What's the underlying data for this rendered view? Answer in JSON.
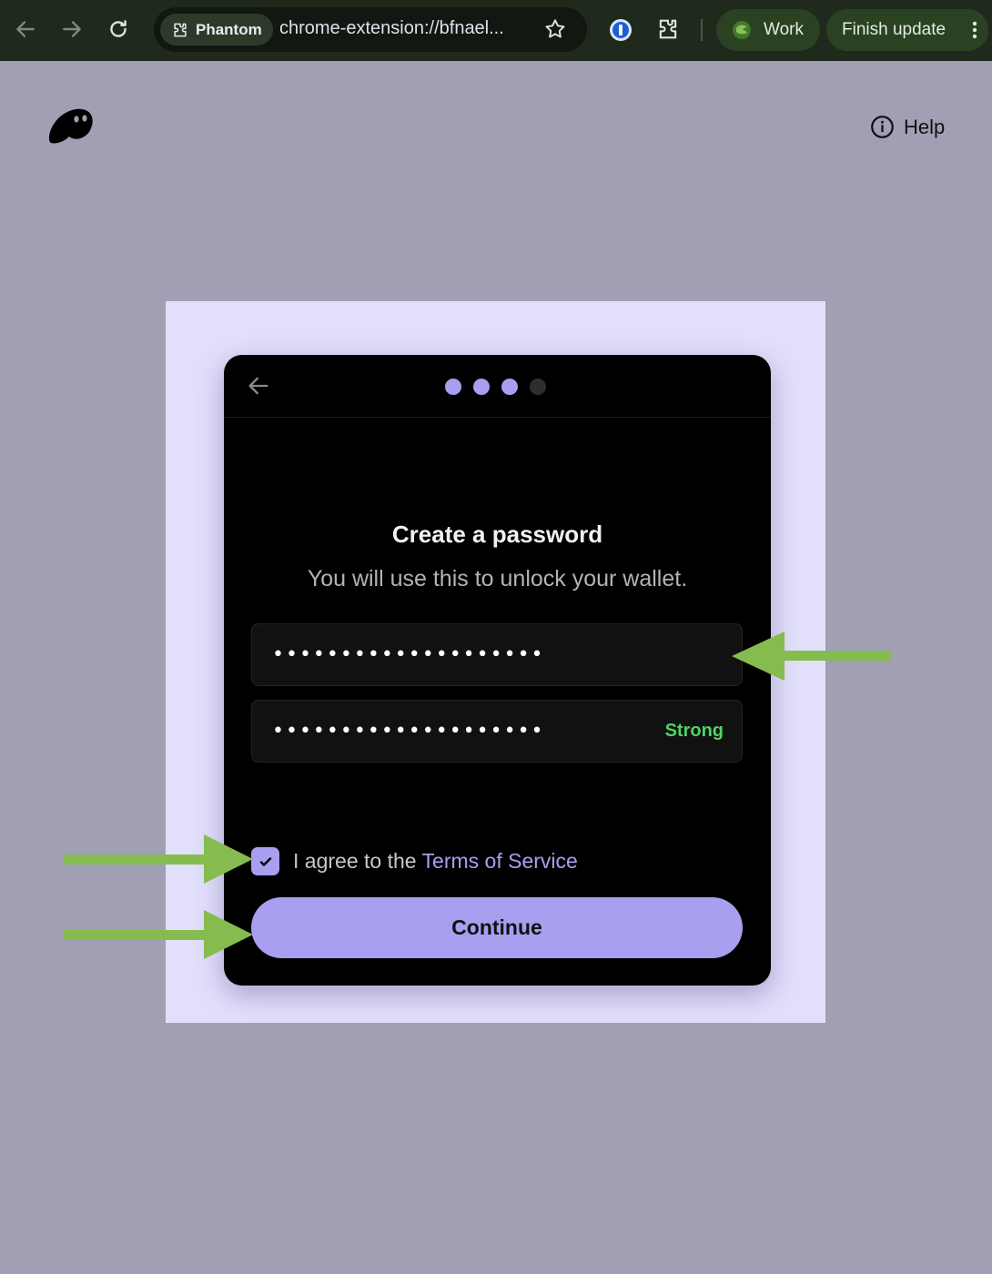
{
  "browser": {
    "site_chip_label": "Phantom",
    "url": "chrome-extension://bfnael...",
    "profile_label": "Work",
    "update_label": "Finish update"
  },
  "header": {
    "help_label": "Help"
  },
  "onboarding": {
    "steps_total": 4,
    "steps_completed": 3,
    "title": "Create a password",
    "subtitle": "You will use this to unlock your wallet.",
    "password_value": "••••••••••••••••••••",
    "confirm_password_value": "••••••••••••••••••••",
    "strength_label": "Strong",
    "agree_prefix": "I agree to the",
    "terms_link_label": "Terms of Service",
    "terms_checked": true,
    "continue_label": "Continue"
  },
  "colors": {
    "accent": "#a89ff0",
    "strength_ok": "#4ed464",
    "annotation_arrow": "#86bb4f",
    "page_background": "#a09fb4",
    "frame_background": "#e2dffb",
    "card_background": "#000000"
  },
  "icons": {
    "nav_back": "arrow-left-icon",
    "nav_forward": "arrow-right-icon",
    "reload": "reload-icon",
    "extension_chip": "puzzle-icon",
    "bookmark": "star-icon",
    "password_manager": "1password-icon",
    "extensions": "puzzle-icon",
    "profile": "profile-avatar-icon",
    "menu": "kebab-menu-icon",
    "logo": "phantom-ghost-logo",
    "help": "info-icon",
    "card_back": "arrow-left-icon",
    "check": "checkmark-icon"
  }
}
